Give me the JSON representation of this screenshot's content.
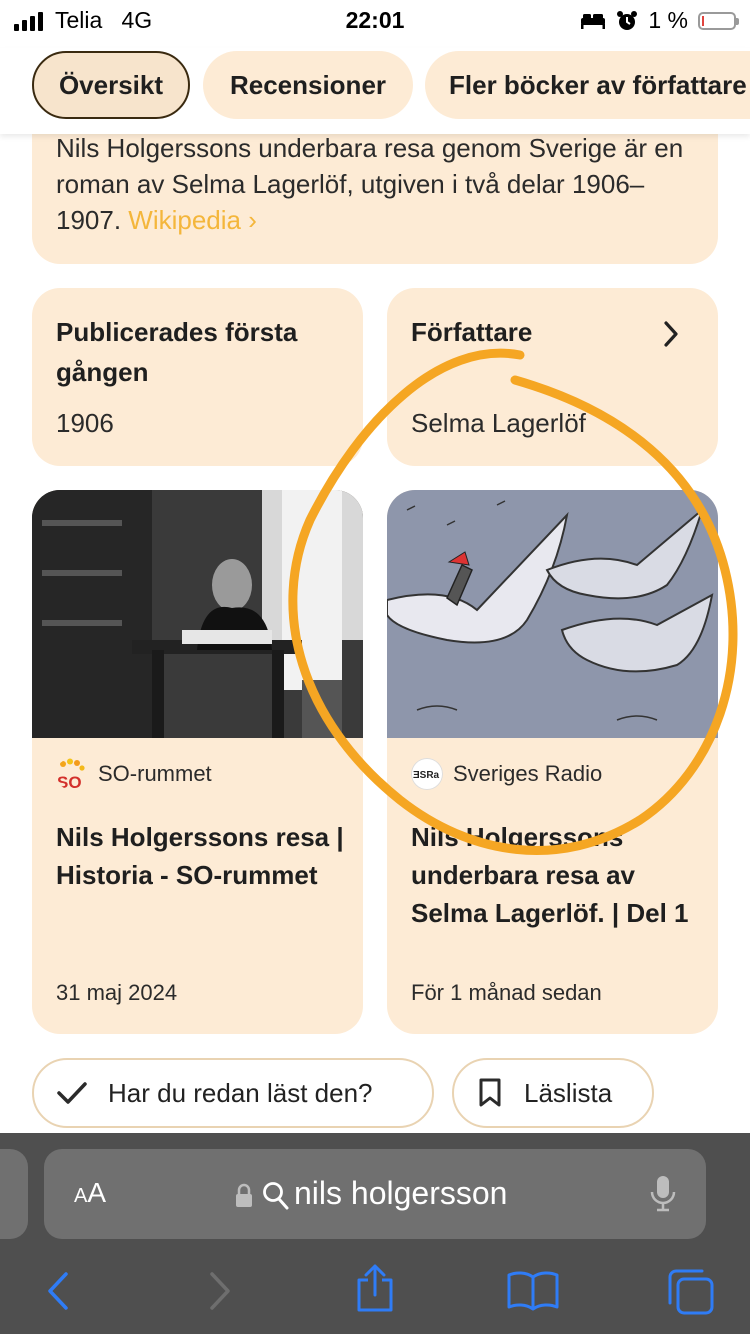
{
  "status_bar": {
    "carrier": "Telia",
    "network": "4G",
    "time": "22:01",
    "battery_percent": "1 %",
    "battery_level": 0.01
  },
  "tabs": [
    {
      "label": "Översikt",
      "active": true
    },
    {
      "label": "Recensioner",
      "active": false
    },
    {
      "label": "Fler böcker av författare",
      "active": false
    }
  ],
  "description": {
    "text": "Nils Holgerssons underbara resa genom Sverige är en roman av Selma Lagerlöf, utgiven i två delar 1906–1907. ",
    "source_link": "Wikipedia",
    "chevron": "›"
  },
  "info": {
    "published_label": "Publicerades första gången",
    "published_value": "1906",
    "author_label": "Författare",
    "author_value": "Selma Lagerlöf",
    "author_chevron": "›"
  },
  "articles": [
    {
      "source": "SO-rummet",
      "title": "Nils Holgerssons resa | Historia - SO-rummet",
      "date": "31 maj 2024"
    },
    {
      "source": "Sveriges Radio",
      "title": "Nils Holgerssons underbara resa av Selma Lagerlöf. | Del 1",
      "date": "För 1 månad sedan"
    }
  ],
  "chips": {
    "read_label": "Har du redan läst den?",
    "reading_list_label": "Läslista"
  },
  "browser": {
    "text_size_label_small": "A",
    "text_size_label_large": "A",
    "query": "nils holgersson"
  },
  "colors": {
    "card_bg": "#fdebd5",
    "wikipedia_link": "#f4b63b",
    "annotation": "#f5a623",
    "ios_blue": "#2f7cf6"
  }
}
